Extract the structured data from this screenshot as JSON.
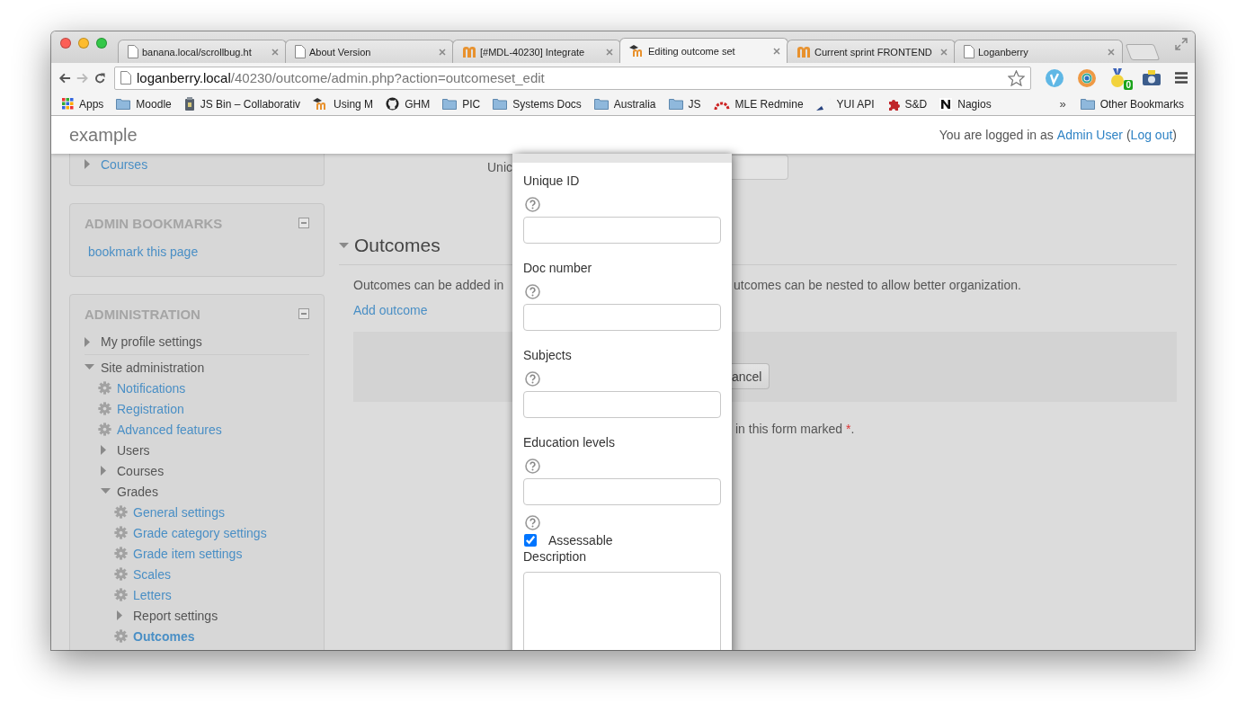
{
  "browser": {
    "tabs": [
      {
        "title": "banana.local/scrollbug.ht",
        "selected": false
      },
      {
        "title": "About Version",
        "selected": false
      },
      {
        "title": "[#MDL-40230] Integrate",
        "selected": false
      },
      {
        "title": "Editing outcome set",
        "selected": true
      },
      {
        "title": "Current sprint FRONTEND",
        "selected": false
      },
      {
        "title": "Loganberry",
        "selected": false
      }
    ],
    "address": {
      "host": "loganberry.local",
      "path": "/40230/outcome/admin.php?action=outcomeset_edit"
    },
    "extension_badge": "0",
    "bookmarks": [
      {
        "label": "Apps"
      },
      {
        "label": "Moodle"
      },
      {
        "label": "JS Bin – Collaborativ"
      },
      {
        "label": "Using M"
      },
      {
        "label": "GHM"
      },
      {
        "label": "PIC"
      },
      {
        "label": "Systems Docs"
      },
      {
        "label": "Australia"
      },
      {
        "label": "JS"
      },
      {
        "label": "MLE Redmine"
      },
      {
        "label": "YUI API"
      },
      {
        "label": "S&D"
      },
      {
        "label": "Nagios"
      }
    ],
    "overflow": "»",
    "other_bookmarks": "Other Bookmarks"
  },
  "navbar": {
    "brand": "example",
    "login_prefix": "You are logged in as",
    "user": "Admin User",
    "open_paren": "(",
    "logout": "Log out",
    "close_paren": ")"
  },
  "sidebar": {
    "blocks": [
      {
        "items": [
          {
            "label": "Courses",
            "kind": "branch_link",
            "expanded": false,
            "selected": false
          }
        ]
      },
      {
        "title": "ADMIN BOOKMARKS",
        "items": [
          {
            "label": "bookmark this page",
            "kind": "link",
            "selected": false
          }
        ]
      },
      {
        "title": "ADMINISTRATION",
        "items": [
          {
            "label": "My profile settings",
            "kind": "branch",
            "expanded": false,
            "selected": false
          },
          {
            "label": "Site administration",
            "kind": "branch",
            "expanded": true,
            "selected": false,
            "children": [
              {
                "label": "Notifications",
                "kind": "setting",
                "selected": false
              },
              {
                "label": "Registration",
                "kind": "setting",
                "selected": false
              },
              {
                "label": "Advanced features",
                "kind": "setting",
                "selected": false
              },
              {
                "label": "Users",
                "kind": "branch",
                "expanded": false,
                "selected": false
              },
              {
                "label": "Courses",
                "kind": "branch",
                "expanded": false,
                "selected": false
              },
              {
                "label": "Grades",
                "kind": "branch",
                "expanded": true,
                "selected": false,
                "children": [
                  {
                    "label": "General settings",
                    "kind": "setting",
                    "selected": false
                  },
                  {
                    "label": "Grade category settings",
                    "kind": "setting",
                    "selected": false
                  },
                  {
                    "label": "Grade item settings",
                    "kind": "setting",
                    "selected": false
                  },
                  {
                    "label": "Scales",
                    "kind": "setting",
                    "selected": false
                  },
                  {
                    "label": "Letters",
                    "kind": "setting",
                    "selected": false
                  },
                  {
                    "label": "Report settings",
                    "kind": "branch",
                    "expanded": false,
                    "selected": false
                  },
                  {
                    "label": "Outcomes",
                    "kind": "setting",
                    "selected": true
                  }
                ]
              }
            ]
          }
        ]
      }
    ]
  },
  "main": {
    "field_label_fragment": "Unic",
    "section": {
      "title": "Outcomes",
      "expanded": true,
      "intro_start": "Outcomes can be added in",
      "intro_end": "utcomes can be nested to allow better organization.",
      "add_link": "Add outcome"
    },
    "cancel_button": "ancel",
    "required_note": {
      "text": "in this form marked",
      "mark": "*",
      "end": "."
    }
  },
  "modal": {
    "fields": [
      {
        "kind": "text",
        "label": "Unique ID"
      },
      {
        "kind": "text",
        "label": "Doc number"
      },
      {
        "kind": "text",
        "label": "Subjects"
      },
      {
        "kind": "text",
        "label": "Education levels"
      },
      {
        "kind": "checkbox",
        "label": "Assessable",
        "checked": true
      },
      {
        "kind": "textarea",
        "label": "Description"
      }
    ]
  }
}
